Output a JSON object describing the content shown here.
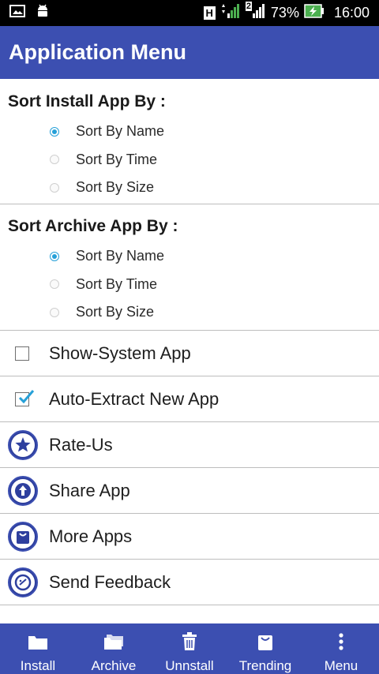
{
  "status_bar": {
    "battery_percent": "73%",
    "time": "16:00",
    "network_badge": "H",
    "sim2_badge": "2"
  },
  "app_bar": {
    "title": "Application Menu"
  },
  "install_sort": {
    "title": "Sort Install App By :",
    "options": [
      "Sort By Name",
      "Sort By Time",
      "Sort By Size"
    ],
    "selected": "Sort By Name"
  },
  "archive_sort": {
    "title": "Sort Archive App By :",
    "options": [
      "Sort By Name",
      "Sort By Time",
      "Sort By Size"
    ],
    "selected": "Sort By Name"
  },
  "settings": {
    "show_system_app": {
      "label": "Show-System App",
      "checked": false
    },
    "auto_extract": {
      "label": "Auto-Extract New App",
      "checked": true
    }
  },
  "actions": {
    "rate_us": {
      "label": "Rate-Us",
      "icon": "star-icon"
    },
    "share_app": {
      "label": "Share App",
      "icon": "share-arrow-icon"
    },
    "more_apps": {
      "label": "More Apps",
      "icon": "bag-icon"
    },
    "send_feedback": {
      "label": "Send Feedback",
      "icon": "feedback-icon"
    }
  },
  "bottom_nav": {
    "items": [
      {
        "label": "Install",
        "icon": "folder-icon"
      },
      {
        "label": "Archive",
        "icon": "folders-icon"
      },
      {
        "label": "Unnstall",
        "icon": "trash-icon"
      },
      {
        "label": "Trending",
        "icon": "shopping-bag-icon"
      },
      {
        "label": "Menu",
        "icon": "more-vert-icon"
      }
    ]
  },
  "colors": {
    "primary": "#3c4fb1",
    "accent": "#26a0d8",
    "battery_green": "#4caf50"
  }
}
